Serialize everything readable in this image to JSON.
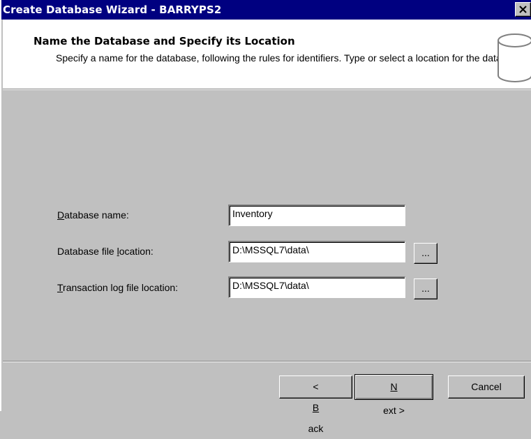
{
  "window": {
    "title": "Create Database Wizard - BARRYPS2"
  },
  "header": {
    "title": "Name the Database and Specify its Location",
    "description": "Specify a name for the database, following the rules for identifiers.  Type or select a location for the database."
  },
  "form": {
    "db_name": {
      "label_accel": "D",
      "label_rest": "atabase name:",
      "value": "Inventory"
    },
    "db_file": {
      "label_pre": "Database file ",
      "label_accel": "l",
      "label_post": "ocation:",
      "value": "D:\\MSSQL7\\data\\",
      "browse_label": "..."
    },
    "log_file": {
      "label_accel": "T",
      "label_rest": "ransaction log file location:",
      "value": "D:\\MSSQL7\\data\\",
      "browse_label": "..."
    }
  },
  "buttons": {
    "back": {
      "pre": "< ",
      "accel": "B",
      "post": "ack"
    },
    "next": {
      "accel": "N",
      "post": "ext >"
    },
    "cancel": "Cancel"
  }
}
